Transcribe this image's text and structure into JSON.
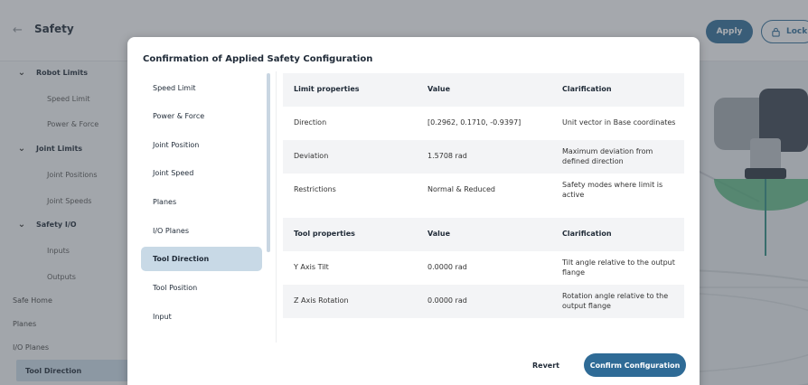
{
  "header": {
    "title": "Safety",
    "apply_label": "Apply",
    "lock_label": "Lock"
  },
  "sidebar": {
    "items": [
      {
        "label": "Robot Limits",
        "kind": "group"
      },
      {
        "label": "Speed Limit",
        "kind": "sub"
      },
      {
        "label": "Power & Force",
        "kind": "sub"
      },
      {
        "label": "Joint Limits",
        "kind": "group"
      },
      {
        "label": "Joint Positions",
        "kind": "sub"
      },
      {
        "label": "Joint Speeds",
        "kind": "sub"
      },
      {
        "label": "Safety I/O",
        "kind": "group"
      },
      {
        "label": "Inputs",
        "kind": "sub"
      },
      {
        "label": "Outputs",
        "kind": "sub"
      },
      {
        "label": "Safe Home",
        "kind": "top"
      },
      {
        "label": "Planes",
        "kind": "top"
      },
      {
        "label": "I/O Planes",
        "kind": "top"
      },
      {
        "label": "Tool Direction",
        "kind": "active"
      }
    ]
  },
  "modal": {
    "title": "Confirmation of Applied Safety Configuration",
    "nav": [
      "Speed Limit",
      "Power & Force",
      "Joint Position",
      "Joint Speed",
      "Planes",
      "I/O Planes",
      "Tool Direction",
      "Tool Position",
      "Input"
    ],
    "nav_selected": "Tool Direction",
    "limit_table": {
      "headers": [
        "Limit properties",
        "Value",
        "Clarification"
      ],
      "rows": [
        [
          "Direction",
          "[0.2962, 0.1710, -0.9397]",
          "Unit vector in Base coordinates"
        ],
        [
          "Deviation",
          "1.5708 rad",
          "Maximum deviation from defined direction"
        ],
        [
          "Restrictions",
          "Normal & Reduced",
          "Safety modes where limit is active"
        ]
      ]
    },
    "tool_table": {
      "headers": [
        "Tool properties",
        "Value",
        "Clarification"
      ],
      "rows": [
        [
          "Y Axis Tilt",
          "0.0000 rad",
          "Tilt angle relative to the output flange"
        ],
        [
          "Z Axis Rotation",
          "0.0000 rad",
          "Rotation angle relative to the output flange"
        ]
      ]
    },
    "revert_label": "Revert",
    "confirm_label": "Confirm Configuration"
  },
  "colors": {
    "accent": "#2f6b96",
    "selection": "#c8d9e6",
    "cone": "#3aa86a"
  }
}
